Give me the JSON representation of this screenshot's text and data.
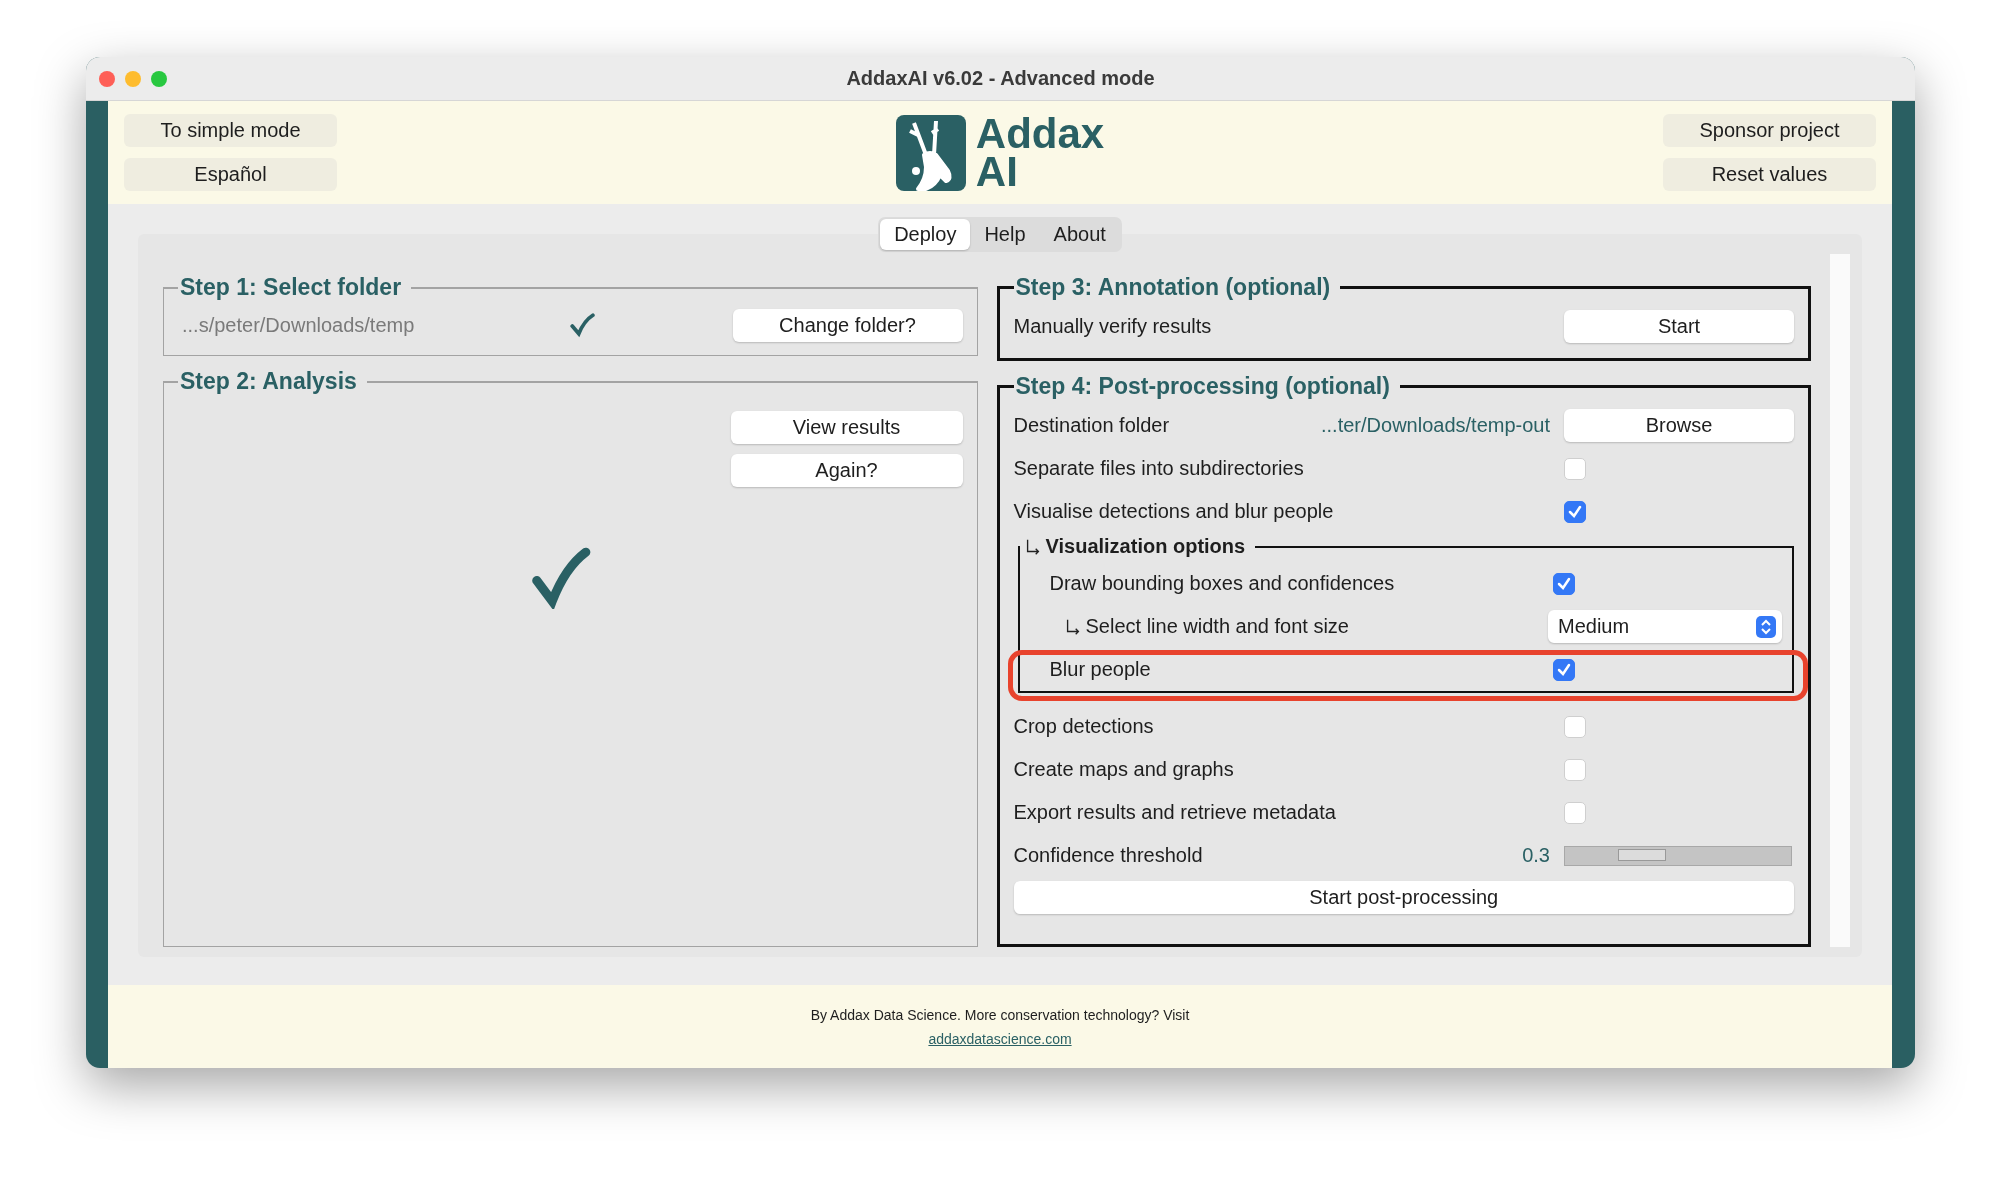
{
  "window": {
    "title": "AddaxAI v6.02 - Advanced mode"
  },
  "header": {
    "left_buttons": [
      "To simple mode",
      "Español"
    ],
    "logo": {
      "line1": "Addax",
      "line2": "AI"
    },
    "right_buttons": [
      "Sponsor project",
      "Reset values"
    ]
  },
  "tabs": [
    {
      "label": "Deploy",
      "selected": true
    },
    {
      "label": "Help",
      "selected": false
    },
    {
      "label": "About",
      "selected": false
    }
  ],
  "step1": {
    "title": "Step 1: Select folder",
    "path": "...s/peter/Downloads/temp",
    "done": true,
    "button": "Change folder?"
  },
  "step2": {
    "title": "Step 2: Analysis",
    "buttons": [
      "View results",
      "Again?"
    ],
    "done": true
  },
  "step3": {
    "title": "Step 3: Annotation (optional)",
    "label": "Manually verify results",
    "button": "Start"
  },
  "step4": {
    "title": "Step 4: Post-processing (optional)",
    "rows": [
      {
        "kind": "folder",
        "label": "Destination folder",
        "value": "...ter/Downloads/temp-out",
        "button": "Browse"
      },
      {
        "kind": "checkbox",
        "label": "Separate files into subdirectories",
        "checked": false
      },
      {
        "kind": "checkbox",
        "label": "Visualise detections and blur people",
        "checked": true
      },
      {
        "kind": "group",
        "title": "Visualization options",
        "children": [
          {
            "kind": "checkbox",
            "label": "Draw bounding boxes and confidences",
            "checked": true,
            "highlighted": false
          },
          {
            "kind": "select",
            "label": "Select line width and font size",
            "value": "Medium",
            "highlighted": false
          },
          {
            "kind": "checkbox",
            "label": "Blur people",
            "checked": true,
            "highlighted": true
          }
        ]
      },
      {
        "kind": "checkbox",
        "label": "Crop detections",
        "checked": false
      },
      {
        "kind": "checkbox",
        "label": "Create maps and graphs",
        "checked": false
      },
      {
        "kind": "checkbox",
        "label": "Export results and retrieve metadata",
        "checked": false
      },
      {
        "kind": "slider",
        "label": "Confidence threshold",
        "reading": "0.3",
        "level": 0.3
      },
      {
        "kind": "button",
        "label": "Start post-processing"
      }
    ]
  },
  "footer": {
    "text": "By Addax Data Science. More conservation technology? Visit",
    "link": "addaxdatascience.com"
  }
}
